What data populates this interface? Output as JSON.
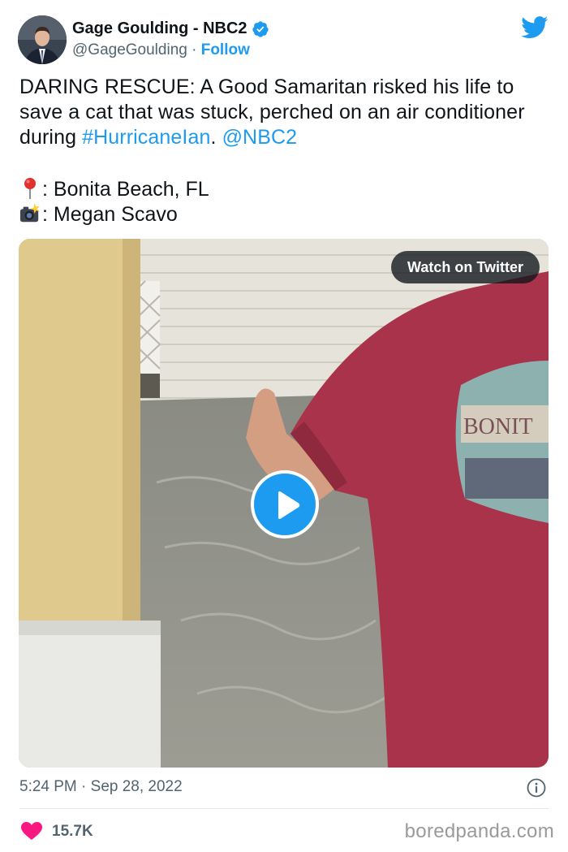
{
  "author": {
    "name": "Gage Goulding - NBC2",
    "handle": "@GageGoulding",
    "separator": " · ",
    "follow_label": "Follow"
  },
  "tweet": {
    "text_before": "DARING RESCUE:  A Good Samaritan risked his life to save a cat that was stuck, perched on an air conditioner during ",
    "hashtag": "#HurricaneIan",
    "text_mid": ".  ",
    "mention": "@NBC2",
    "location_label": ": Bonita Beach, FL",
    "credit_label": ": Megan Scavo"
  },
  "media": {
    "watch_label": "Watch on Twitter",
    "shirt_text": "BONIT"
  },
  "footer": {
    "timestamp": "5:24 PM · Sep 28, 2022",
    "like_count": "15.7K",
    "watermark": "boredpanda.com"
  },
  "icons": {
    "verified": "verified-badge-icon",
    "bird": "twitter-bird-icon",
    "pin": "round-pushpin-emoji",
    "camera": "camera-flash-emoji",
    "play": "play-icon",
    "info": "info-icon",
    "heart": "heart-icon"
  },
  "colors": {
    "accent": "#1d9bf0",
    "heart": "#f91880",
    "secondary_text": "#536471"
  }
}
